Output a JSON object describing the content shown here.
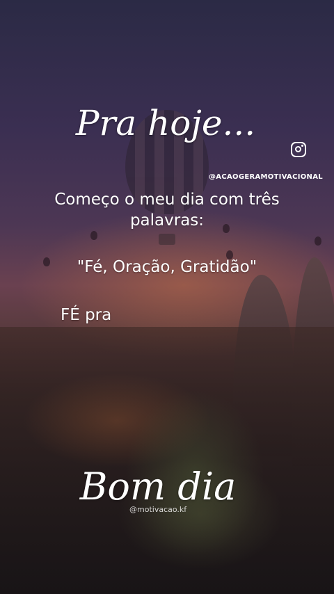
{
  "story": {
    "title": "Pra hoje...",
    "instagram_handle": "@ACAOGERAMOTIVACIONAL",
    "message_line": "Começo o meu dia com três palavras:",
    "quote": "\"Fé, Oração, Gratidão\"",
    "fe_text": "FÉ pra",
    "greeting": "Bom dia",
    "watermark": "@motivacao.kf"
  },
  "icons": {
    "instagram": "instagram-icon"
  },
  "colors": {
    "text": "#ffffff",
    "sky_top": "#2b2a45",
    "horizon": "#6a4150"
  }
}
